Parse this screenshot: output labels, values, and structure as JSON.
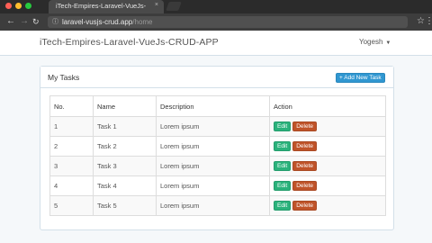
{
  "browser": {
    "tab_title": "iTech-Empires-Laravel-VueJs-...",
    "tab_close": "×",
    "url_host": "laravel-vusjs-crud.app",
    "url_path": "/home",
    "icons": {
      "back": "back-arrow-icon",
      "forward": "forward-arrow-icon",
      "reload": "reload-icon",
      "info": "page-info-icon",
      "star": "star-icon",
      "menu": "kebab-menu-icon"
    }
  },
  "navbar": {
    "brand": "iTech-Empires-Laravel-VueJs-CRUD-APP",
    "user": "Yogesh"
  },
  "panel": {
    "title": "My Tasks",
    "add_button": "+ Add New Task"
  },
  "table": {
    "headers": [
      "No.",
      "Name",
      "Description",
      "Action"
    ],
    "rows": [
      {
        "no": "1",
        "name": "Task 1",
        "description": "Lorem ipsum",
        "edit": "Edit",
        "delete": "Delete"
      },
      {
        "no": "2",
        "name": "Task 2",
        "description": "Lorem ipsum",
        "edit": "Edit",
        "delete": "Delete"
      },
      {
        "no": "3",
        "name": "Task 3",
        "description": "Lorem ipsum",
        "edit": "Edit",
        "delete": "Delete"
      },
      {
        "no": "4",
        "name": "Task 4",
        "description": "Lorem ipsum",
        "edit": "Edit",
        "delete": "Delete"
      },
      {
        "no": "5",
        "name": "Task 5",
        "description": "Lorem ipsum",
        "edit": "Edit",
        "delete": "Delete"
      }
    ]
  },
  "colors": {
    "primary": "#3097d1",
    "success": "#2ab27b",
    "danger": "#bf5329"
  }
}
